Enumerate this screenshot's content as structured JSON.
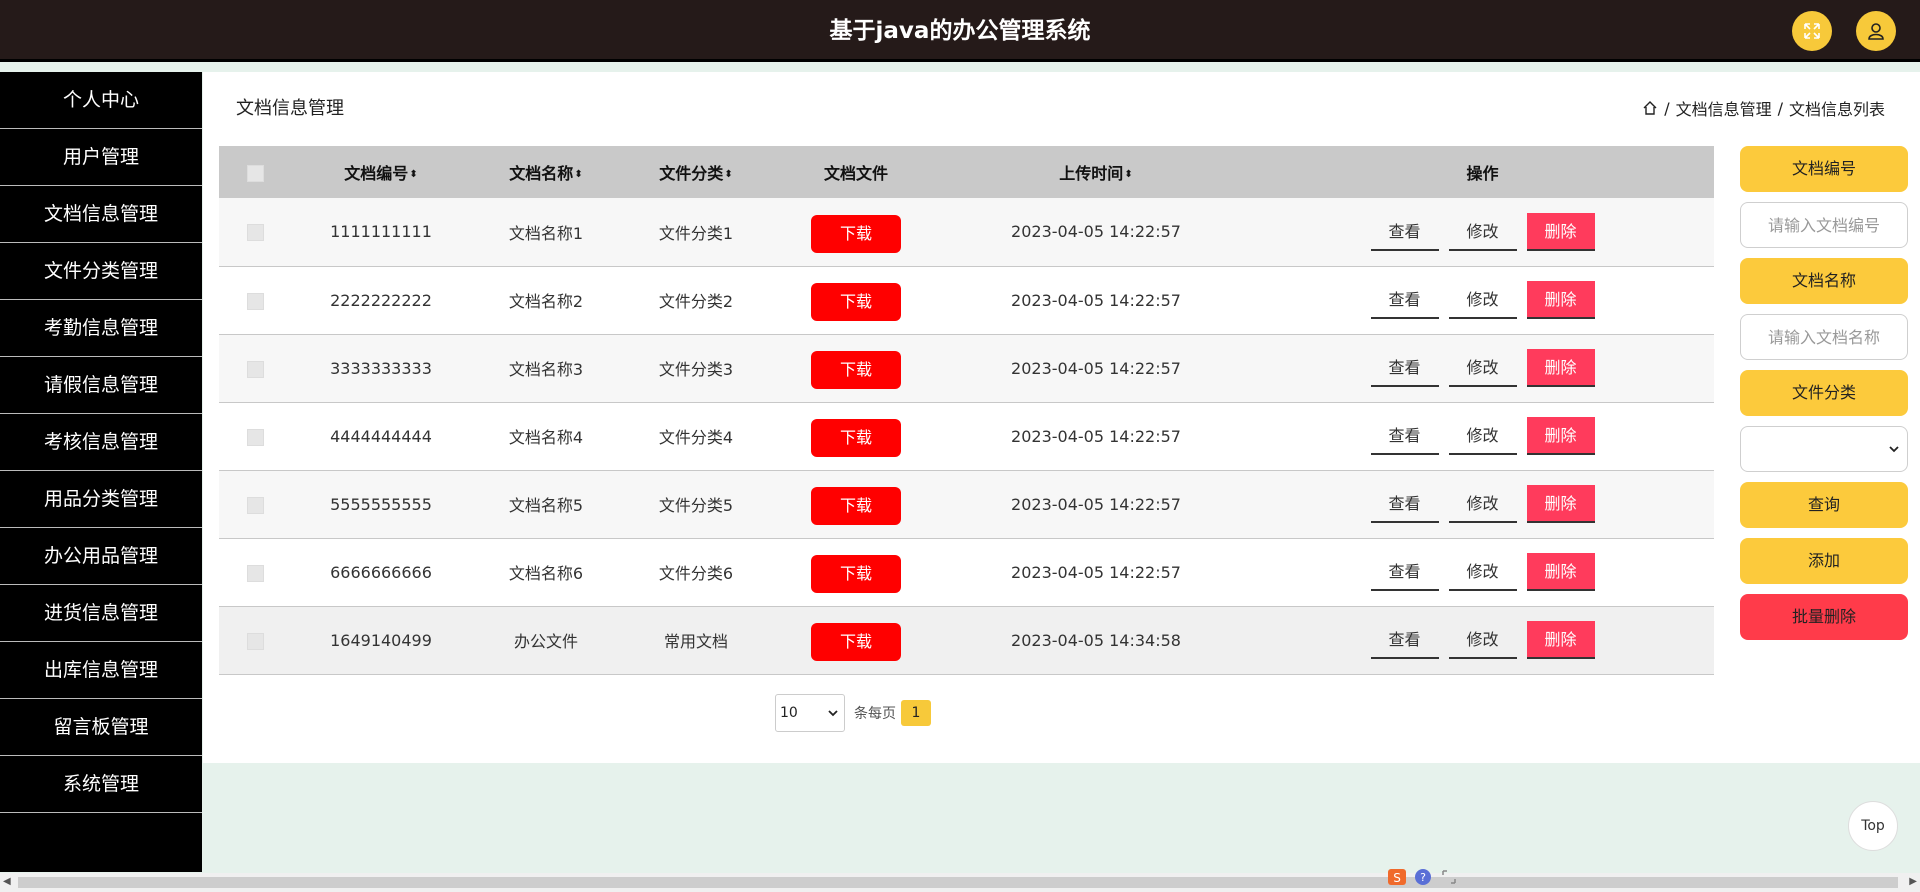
{
  "header": {
    "title": "基于java的办公管理系统"
  },
  "sidebar": {
    "items": [
      {
        "label": "个人中心"
      },
      {
        "label": "用户管理"
      },
      {
        "label": "文档信息管理"
      },
      {
        "label": "文件分类管理"
      },
      {
        "label": "考勤信息管理"
      },
      {
        "label": "请假信息管理"
      },
      {
        "label": "考核信息管理"
      },
      {
        "label": "用品分类管理"
      },
      {
        "label": "办公用品管理"
      },
      {
        "label": "进货信息管理"
      },
      {
        "label": "出库信息管理"
      },
      {
        "label": "留言板管理"
      },
      {
        "label": "系统管理"
      }
    ]
  },
  "page": {
    "title": "文档信息管理",
    "breadcrumb": [
      "文档信息管理",
      "文档信息列表"
    ]
  },
  "table": {
    "columns": [
      "文档编号",
      "文档名称",
      "文件分类",
      "文档文件",
      "上传时间",
      "操作"
    ],
    "download_label": "下载",
    "view_label": "查看",
    "edit_label": "修改",
    "delete_label": "删除",
    "rows": [
      {
        "code": "1111111111",
        "name": "文档名称1",
        "category": "文件分类1",
        "time": "2023-04-05 14:22:57"
      },
      {
        "code": "2222222222",
        "name": "文档名称2",
        "category": "文件分类2",
        "time": "2023-04-05 14:22:57"
      },
      {
        "code": "3333333333",
        "name": "文档名称3",
        "category": "文件分类3",
        "time": "2023-04-05 14:22:57"
      },
      {
        "code": "4444444444",
        "name": "文档名称4",
        "category": "文件分类4",
        "time": "2023-04-05 14:22:57"
      },
      {
        "code": "5555555555",
        "name": "文档名称5",
        "category": "文件分类5",
        "time": "2023-04-05 14:22:57"
      },
      {
        "code": "6666666666",
        "name": "文档名称6",
        "category": "文件分类6",
        "time": "2023-04-05 14:22:57"
      },
      {
        "code": "1649140499",
        "name": "办公文件",
        "category": "常用文档",
        "time": "2023-04-05 14:34:58"
      }
    ]
  },
  "pagination": {
    "page_size": "10",
    "per_page_label": "条每页",
    "current_page": "1"
  },
  "search": {
    "code_label": "文档编号",
    "code_placeholder": "请输入文档编号",
    "name_label": "文档名称",
    "name_placeholder": "请输入文档名称",
    "category_label": "文件分类",
    "query_label": "查询",
    "add_label": "添加",
    "batch_delete_label": "批量删除"
  },
  "back_to_top": "Top",
  "colors": {
    "accent": "#fcca3c",
    "danger": "#ff0000",
    "header_bg": "#251a19",
    "sidebar_bg": "#000000"
  }
}
